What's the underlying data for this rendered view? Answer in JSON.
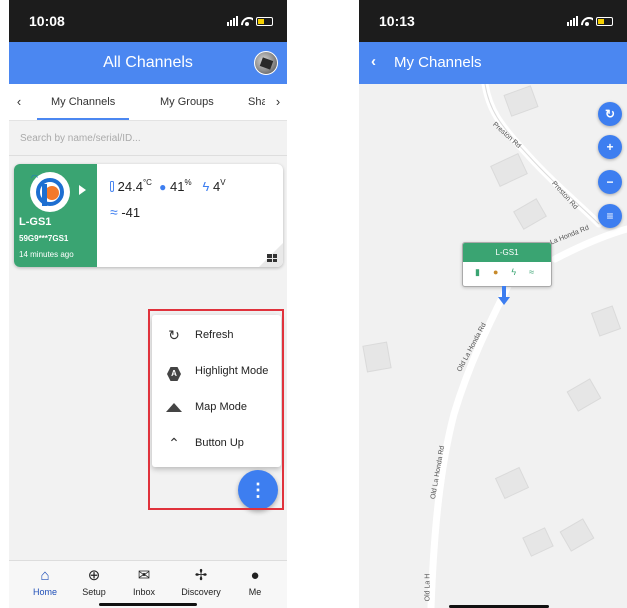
{
  "phone1": {
    "status_time": "10:08",
    "title": "All Channels",
    "tabs": [
      "My Channels",
      "My Groups",
      "Sha"
    ],
    "search_placeholder": "Search by name/serial/ID...",
    "card": {
      "name": "L-GS1",
      "serial": "59G9***7GS1",
      "ago": "14 minutes ago",
      "temp": "24.4",
      "temp_unit": "°C",
      "humidity": "41",
      "humidity_unit": "%",
      "voltage": "4",
      "voltage_unit": "V",
      "rssi": "-41"
    },
    "menu": [
      {
        "label": "Refresh",
        "icon": "refresh-icon"
      },
      {
        "label": "Highlight Mode",
        "icon": "highlight-hex-icon"
      },
      {
        "label": "Map Mode",
        "icon": "mountain-icon"
      },
      {
        "label": "Button Up",
        "icon": "chevron-up-icon"
      }
    ],
    "fab_icon": "more-vert-icon",
    "nav": [
      {
        "label": "Home",
        "icon": "home-icon"
      },
      {
        "label": "Setup",
        "icon": "add-circle-icon"
      },
      {
        "label": "Inbox",
        "icon": "mail-icon"
      },
      {
        "label": "Discovery",
        "icon": "fan-icon"
      },
      {
        "label": "Me",
        "icon": "person-icon"
      }
    ],
    "colors": {
      "primary": "#4b87f1",
      "card_green": "#3aa472",
      "highlight_border": "#e0323c"
    }
  },
  "phone2": {
    "status_time": "10:13",
    "title": "My Channels",
    "roads": [
      "Preston Rd",
      "Preston Rd",
      "La Honda Rd",
      "Old La Honda Rd",
      "Old La Honda Rd",
      "Old La H"
    ],
    "marker_name": "L-GS1",
    "map_buttons": [
      "refresh-icon",
      "zoom-in-icon",
      "zoom-out-icon",
      "list-icon"
    ]
  }
}
